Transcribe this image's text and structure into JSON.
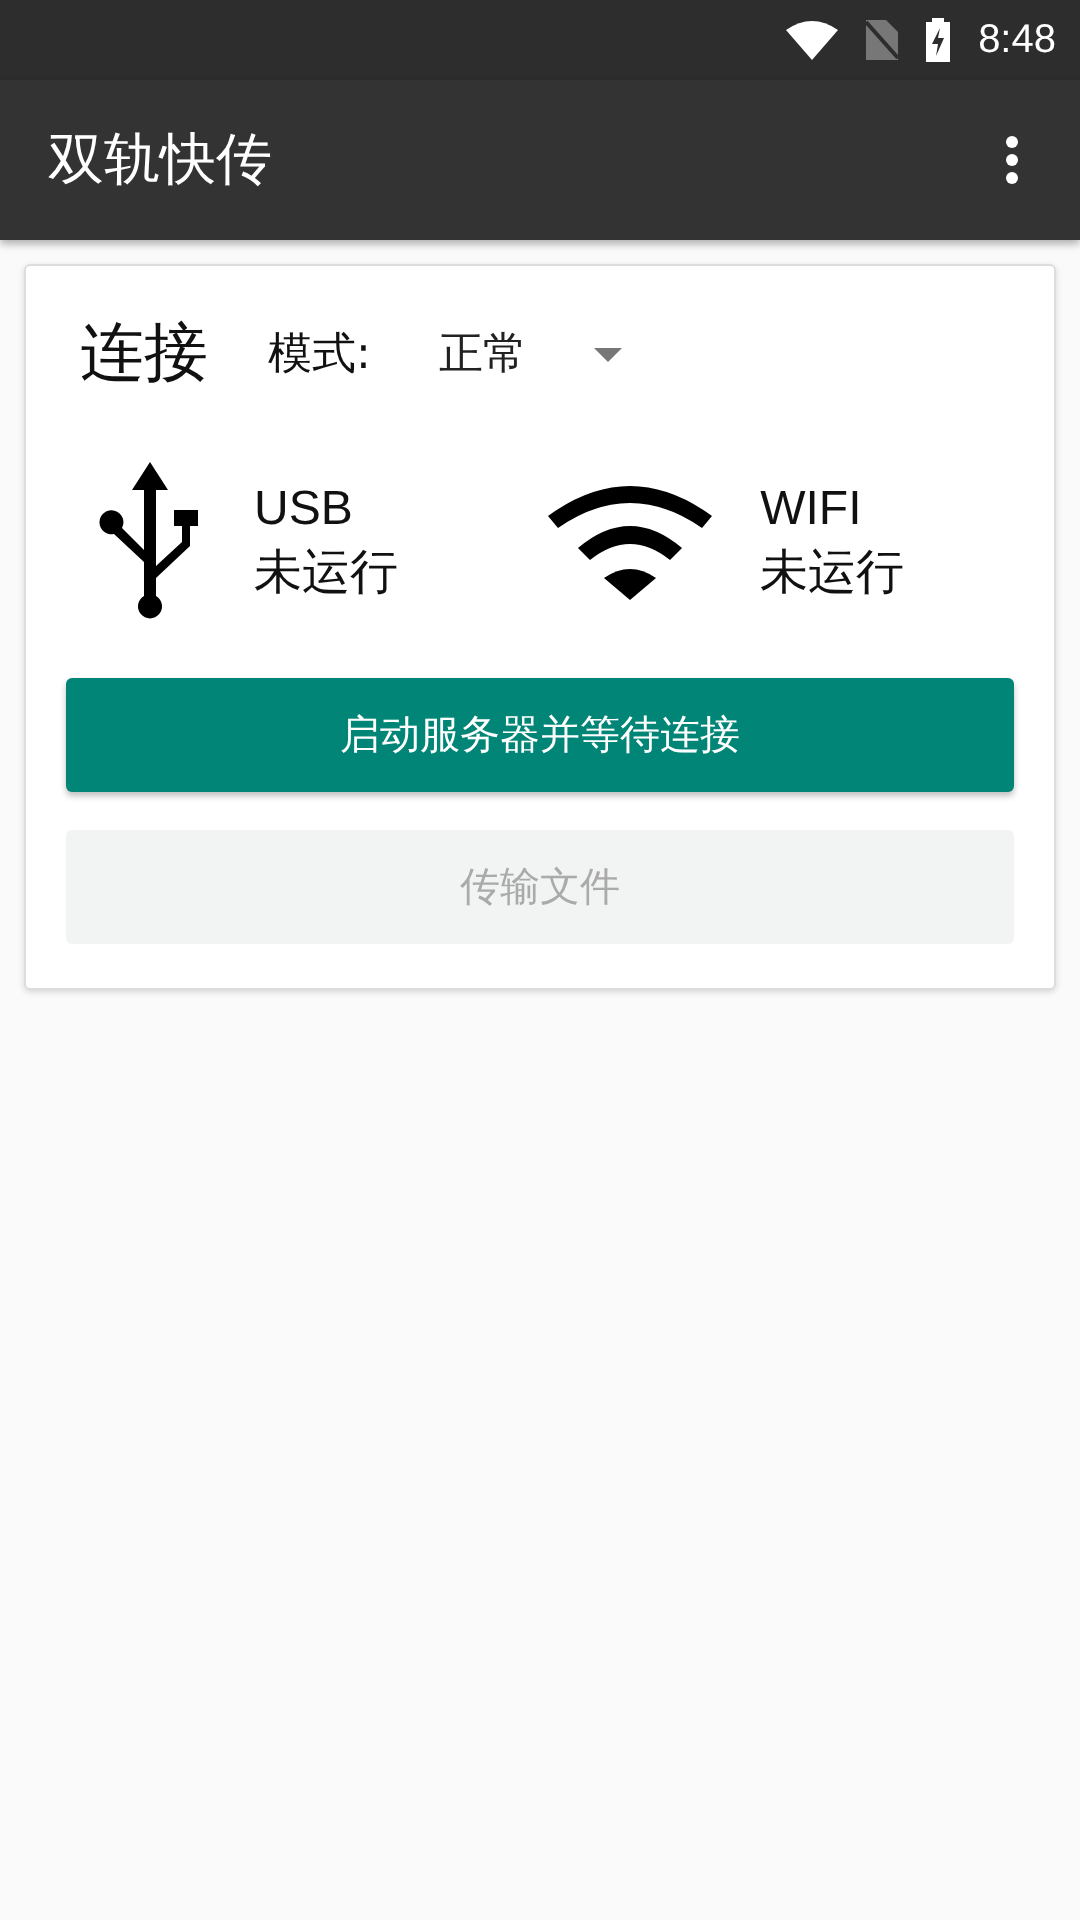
{
  "status_bar": {
    "time": "8:48"
  },
  "app_bar": {
    "title": "双轨快传"
  },
  "card": {
    "title": "连接",
    "mode_label": "模式:",
    "mode_value": "正常",
    "connections": [
      {
        "kind": "usb",
        "name": "USB",
        "status": "未运行"
      },
      {
        "kind": "wifi",
        "name": "WIFI",
        "status": "未运行"
      }
    ],
    "buttons": [
      {
        "label": "启动服务器并等待连接",
        "disabled": false
      },
      {
        "label": "传输文件",
        "disabled": true
      }
    ]
  }
}
